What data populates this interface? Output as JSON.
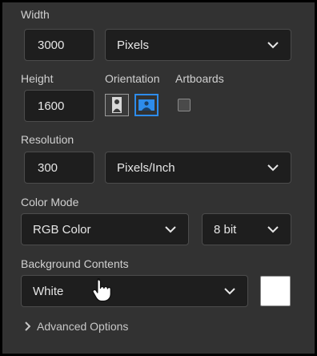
{
  "width": {
    "label": "Width",
    "value": "3000",
    "unit": "Pixels"
  },
  "height": {
    "label": "Height",
    "value": "1600"
  },
  "orientation": {
    "label": "Orientation",
    "selected": "landscape"
  },
  "artboards": {
    "label": "Artboards",
    "checked": false
  },
  "resolution": {
    "label": "Resolution",
    "value": "300",
    "unit": "Pixels/Inch"
  },
  "color_mode": {
    "label": "Color Mode",
    "mode": "RGB Color",
    "depth": "8 bit"
  },
  "background": {
    "label": "Background Contents",
    "value": "White",
    "swatch_color": "#ffffff"
  },
  "advanced": {
    "label": "Advanced Options"
  },
  "colors": {
    "accent": "#2d8ceb",
    "panel": "#323232",
    "field": "#1e1e1e"
  }
}
